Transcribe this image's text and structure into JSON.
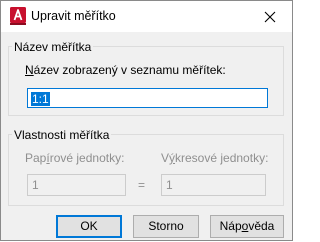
{
  "window": {
    "title": "Upravit měřítko",
    "app_icon": "autocad-app-icon",
    "close_icon": "close-icon"
  },
  "group_name": {
    "heading": "Název měřítka",
    "field_label_ul": "N",
    "field_label_rest": "ázev zobrazený v seznamu měřítek:",
    "field_value": "1:1"
  },
  "group_props": {
    "heading": "Vlastnosti měřítka",
    "paper_label_pre": "Pap",
    "paper_label_ul": "í",
    "paper_label_post": "rové jednotky:",
    "drawing_label_pre": "V",
    "drawing_label_ul": "ý",
    "drawing_label_post": "kresové jednotky:",
    "paper_value": "1",
    "equals": "=",
    "drawing_value": "1"
  },
  "buttons": {
    "ok": "OK",
    "cancel": "Storno",
    "help_pre": "Náp",
    "help_ul": "o",
    "help_post": "věda"
  },
  "colors": {
    "accent": "#0078d7",
    "app_icon_red": "#c8102e"
  }
}
